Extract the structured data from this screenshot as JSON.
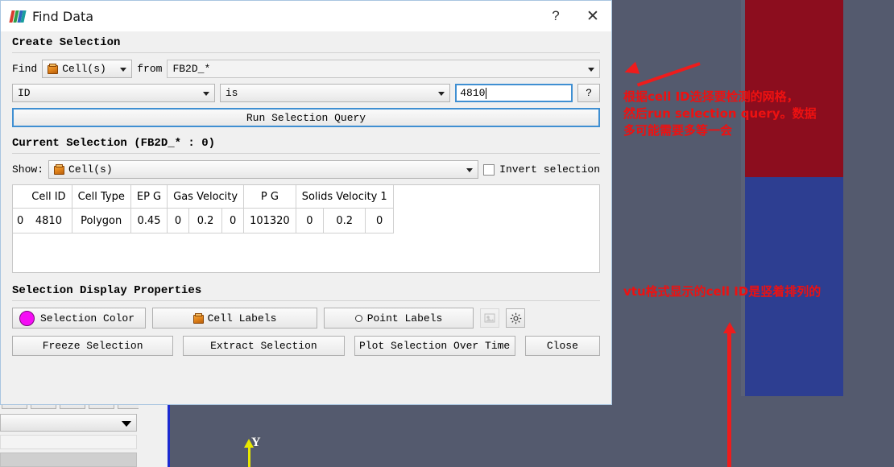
{
  "dialog": {
    "title": "Find Data",
    "logo_icon": "paraview-logo-icon",
    "help_button": "?",
    "close_button": "✕",
    "sections": {
      "create_selection": "Create Selection",
      "current_selection": "Current Selection (FB2D_* : 0)",
      "display_properties": "Selection Display Properties"
    },
    "find_row": {
      "find_label": "Find",
      "type_value": "Cell(s)",
      "type_icon": "cube-icon",
      "from_label": "from",
      "source_value": "FB2D_*"
    },
    "query_row": {
      "field_value": "ID",
      "operator_value": "is",
      "value": "4810",
      "help_button": "?"
    },
    "run_query_button": "Run Selection Query",
    "show_row": {
      "show_label": "Show:",
      "show_value": "Cell(s)",
      "show_icon": "cube-icon",
      "invert_label": "Invert selection",
      "invert_checked": false
    },
    "display_properties": {
      "selection_color_label": "Selection Color",
      "selection_color_hex": "#f50df5",
      "cell_labels_label": "Cell Labels",
      "cell_labels_icon": "cube-icon",
      "point_labels_label": "Point Labels",
      "point_labels_icon": "point-icon",
      "edit_labels_icon": "edit-labels-icon",
      "settings_icon": "gear-icon"
    },
    "action_buttons": {
      "freeze": "Freeze Selection",
      "extract": "Extract Selection",
      "plot": "Plot Selection Over Time",
      "close": "Close"
    }
  },
  "selection_table": {
    "row_index_header": "",
    "columns": [
      "Cell ID",
      "Cell Type",
      "EP G",
      "Gas Velocity",
      "P G",
      "Solids Velocity 1"
    ],
    "subcolumn_spans": [
      1,
      1,
      1,
      3,
      1,
      3
    ],
    "rows": [
      {
        "index": "0",
        "cells": [
          "4810",
          "Polygon",
          "0.45",
          "0",
          "0.2",
          "0",
          "101320",
          "0",
          "0.2",
          "0"
        ]
      }
    ]
  },
  "annotations": {
    "top_text": "根据cell ID选择要检测的网格，\n然后run selection query。数据\n多可能需要多等一会",
    "bottom_text": "vtu格式显示的cell ID是竖着排列的",
    "color_hex": "#ee1111",
    "arrow_icon": "red-arrow-icon",
    "vertical_arrow_icon": "red-vertical-arrow-icon"
  },
  "render_view": {
    "axis_label": "Y",
    "axis_color_hex": "#e8e800",
    "background_hex": "#545a6e",
    "mesh_top_color_hex": "#8c0d1e",
    "mesh_bottom_color_hex": "#2d3e91",
    "selected_cell_marker_hex": "#ff3bff"
  }
}
